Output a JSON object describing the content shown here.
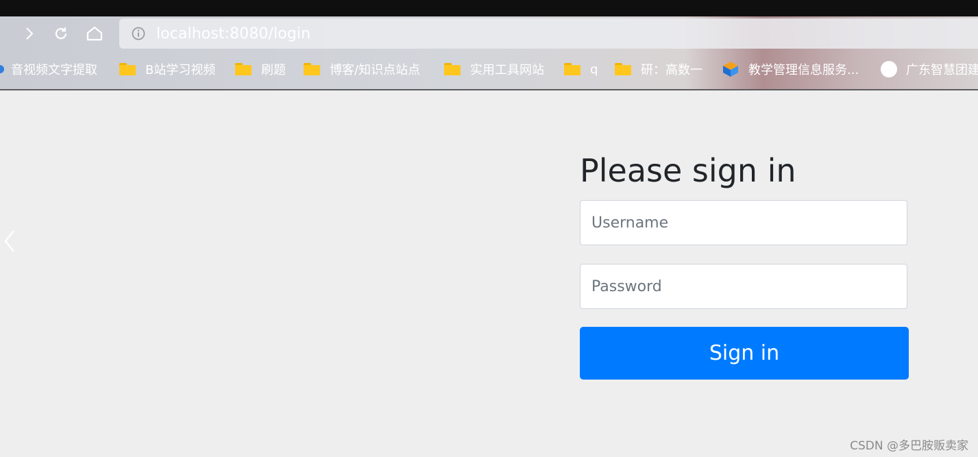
{
  "browser": {
    "url": "localhost:8080/login",
    "bookmarks": [
      {
        "label": "音视频文字提取",
        "icon": "blue-dot-icon"
      },
      {
        "label": "B站学习视频",
        "icon": "folder-icon"
      },
      {
        "label": "刷题",
        "icon": "folder-icon"
      },
      {
        "label": "博客/知识点站点",
        "icon": "folder-icon"
      },
      {
        "label": "实用工具网站",
        "icon": "folder-icon"
      },
      {
        "label": "q",
        "icon": "folder-icon"
      },
      {
        "label": "研：高数一",
        "icon": "folder-icon"
      },
      {
        "label": "教学管理信息服务...",
        "icon": "cube-site-icon"
      },
      {
        "label": "广东智慧团建",
        "icon": "white-circle-icon"
      }
    ]
  },
  "login": {
    "title": "Please sign in",
    "username_placeholder": "Username",
    "password_placeholder": "Password",
    "submit_label": "Sign in"
  },
  "watermark": "CSDN @多巴胺贩卖家",
  "colors": {
    "primary": "#007bff",
    "page_background": "#eeeeee",
    "title_text": "#212529"
  }
}
